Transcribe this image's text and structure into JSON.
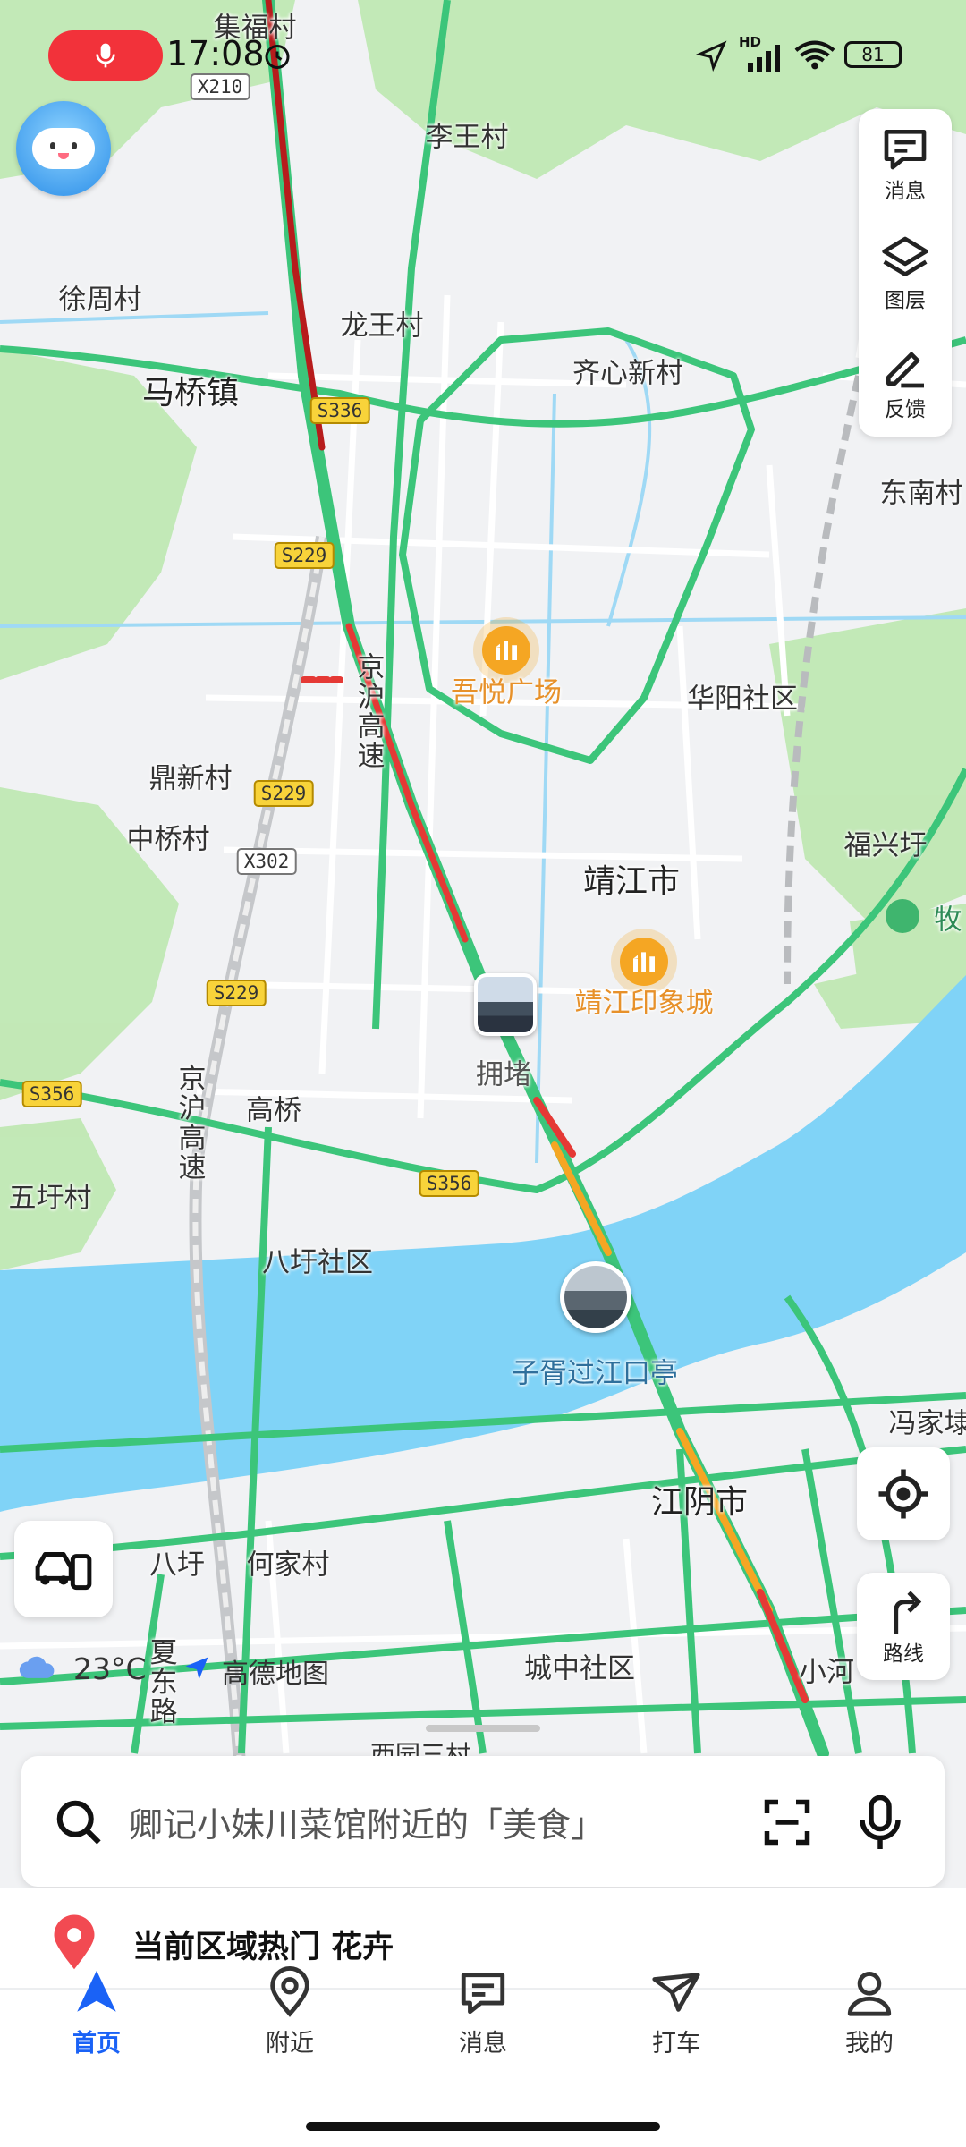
{
  "status_bar": {
    "time": "17:08",
    "battery": "81",
    "net": "HD"
  },
  "colors": {
    "accent": "#1a62f6",
    "road_green": "#35c26b",
    "water": "#7fd2f5",
    "mic_red": "#f2323a"
  },
  "map": {
    "places": [
      "集福村",
      "李王村",
      "徐周村",
      "龙王村",
      "马桥镇",
      "齐心新村",
      "东南村",
      "华阳社区",
      "鼎新村",
      "中桥村",
      "靖江市",
      "福兴圩",
      "高桥",
      "五圩村",
      "八圩社区",
      "冯家埭",
      "八圩",
      "何家村",
      "城中社区",
      "小河",
      "西园三村",
      "牧"
    ],
    "pois": [
      "吾悦广场",
      "靖江印象城"
    ],
    "traffic_photo_label": "拥堵",
    "landmark_label": "子胥过江口亭",
    "city_label": "江阴市",
    "expressway_labels": [
      "京沪高速",
      "京沪高速",
      "夏东路"
    ],
    "road_shields": [
      "X210",
      "S336",
      "S229",
      "S229",
      "X302",
      "S229",
      "S356",
      "S356"
    ]
  },
  "side_panel": {
    "items": [
      "消息",
      "图层",
      "反馈"
    ]
  },
  "route_button": "路线",
  "weather": {
    "temp": "23°C",
    "brand": "高德地图"
  },
  "search": {
    "placeholder": "卿记小妹川菜馆附近的「美食」"
  },
  "hot_area": {
    "prefix": "当前区域热门",
    "topic": "花卉"
  },
  "tabs": [
    {
      "label": "首页",
      "active": true
    },
    {
      "label": "附近",
      "active": false
    },
    {
      "label": "消息",
      "active": false
    },
    {
      "label": "打车",
      "active": false
    },
    {
      "label": "我的",
      "active": false
    }
  ]
}
